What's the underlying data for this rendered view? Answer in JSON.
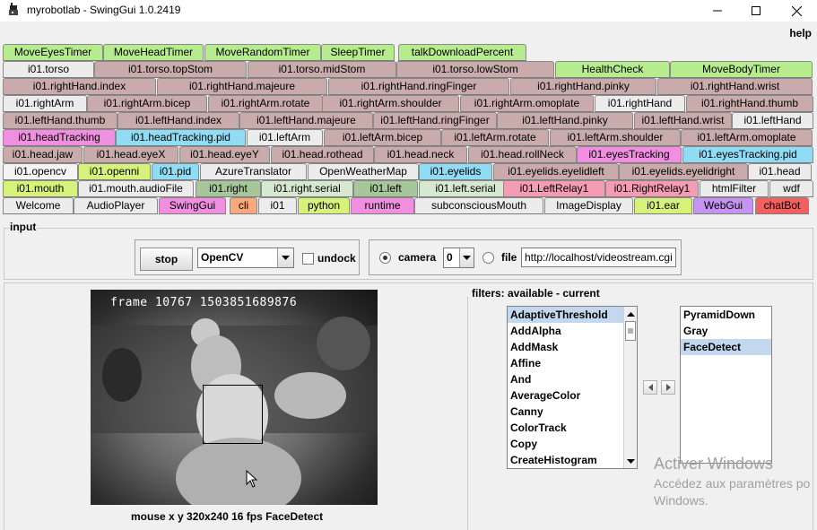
{
  "window": {
    "title": "myrobotlab - SwingGui 1.0.2419",
    "icon": "robot-app-icon",
    "controls": [
      "minimize-icon",
      "maximize-icon",
      "close-icon"
    ]
  },
  "menu": {
    "help": "help"
  },
  "colors": {
    "green": "#b6ec8e",
    "mauve": "#c9abab",
    "pink": "#f08fe0",
    "cyan": "#8fdcf4",
    "lime": "#d6f27a",
    "sage": "#a7c69a",
    "mint": "#d7e8d0",
    "rose": "#f59bb4",
    "orange": "#fba97a",
    "purple": "#c594f2",
    "red": "#f55f5f",
    "grey": "#ececec",
    "selected": "#f4f4f4",
    "list_selection": "#c3d7ef"
  },
  "tabs": [
    [
      {
        "label": "MoveEyesTimer",
        "color": "green"
      },
      {
        "label": "MoveHeadTimer",
        "color": "green"
      },
      {
        "label": "MoveRandomTimer",
        "color": "green"
      },
      {
        "label": "SleepTimer",
        "color": "green"
      },
      {
        "label": "talkDownloadPercent",
        "color": "green"
      }
    ],
    [
      {
        "label": "i01.torso",
        "color": "grey"
      },
      {
        "label": "i01.torso.topStom",
        "color": "mauve"
      },
      {
        "label": "i01.torso.midStom",
        "color": "mauve"
      },
      {
        "label": "i01.torso.lowStom",
        "color": "mauve"
      },
      {
        "label": "HealthCheck",
        "color": "green"
      },
      {
        "label": "MoveBodyTimer",
        "color": "green"
      }
    ],
    [
      {
        "label": "i01.rightHand.index",
        "color": "mauve"
      },
      {
        "label": "i01.rightHand.majeure",
        "color": "mauve"
      },
      {
        "label": "i01.rightHand.ringFinger",
        "color": "mauve"
      },
      {
        "label": "i01.rightHand.pinky",
        "color": "mauve"
      },
      {
        "label": "i01.rightHand.wrist",
        "color": "mauve"
      }
    ],
    [
      {
        "label": "i01.rightArm",
        "color": "grey"
      },
      {
        "label": "i01.rightArm.bicep",
        "color": "mauve"
      },
      {
        "label": "i01.rightArm.rotate",
        "color": "mauve"
      },
      {
        "label": "i01.rightArm.shoulder",
        "color": "mauve"
      },
      {
        "label": "i01.rightArm.omoplate",
        "color": "mauve"
      },
      {
        "label": "i01.rightHand",
        "color": "grey"
      },
      {
        "label": "i01.rightHand.thumb",
        "color": "mauve"
      }
    ],
    [
      {
        "label": "i01.leftHand.thumb",
        "color": "mauve"
      },
      {
        "label": "i01.leftHand.index",
        "color": "mauve"
      },
      {
        "label": "i01.leftHand.majeure",
        "color": "mauve"
      },
      {
        "label": "i01.leftHand.ringFinger",
        "color": "mauve"
      },
      {
        "label": "i01.leftHand.pinky",
        "color": "mauve"
      },
      {
        "label": "i01.leftHand.wrist",
        "color": "mauve"
      },
      {
        "label": "i01.leftHand",
        "color": "grey"
      }
    ],
    [
      {
        "label": "i01.headTracking",
        "color": "pink"
      },
      {
        "label": "i01.headTracking.pid",
        "color": "cyan"
      },
      {
        "label": "i01.leftArm",
        "color": "grey"
      },
      {
        "label": "i01.leftArm.bicep",
        "color": "mauve"
      },
      {
        "label": "i01.leftArm.rotate",
        "color": "mauve"
      },
      {
        "label": "i01.leftArm.shoulder",
        "color": "mauve"
      },
      {
        "label": "i01.leftArm.omoplate",
        "color": "mauve"
      }
    ],
    [
      {
        "label": "i01.head.jaw",
        "color": "mauve"
      },
      {
        "label": "i01.head.eyeX",
        "color": "mauve"
      },
      {
        "label": "i01.head.eyeY",
        "color": "mauve"
      },
      {
        "label": "i01.head.rothead",
        "color": "mauve"
      },
      {
        "label": "i01.head.neck",
        "color": "mauve"
      },
      {
        "label": "i01.head.rollNeck",
        "color": "mauve"
      },
      {
        "label": "i01.eyesTracking",
        "color": "pink"
      },
      {
        "label": "i01.eyesTracking.pid",
        "color": "cyan"
      }
    ],
    [
      {
        "label": "i01.opencv",
        "color": "cyan",
        "selected": true
      },
      {
        "label": "i01.openni",
        "color": "lime"
      },
      {
        "label": "i01.pid",
        "color": "cyan"
      },
      {
        "label": "AzureTranslator",
        "color": "grey"
      },
      {
        "label": "OpenWeatherMap",
        "color": "grey"
      },
      {
        "label": "i01.eyelids",
        "color": "cyan"
      },
      {
        "label": "i01.eyelids.eyelidleft",
        "color": "mauve"
      },
      {
        "label": "i01.eyelids.eyelidright",
        "color": "mauve"
      },
      {
        "label": "i01.head",
        "color": "grey"
      }
    ],
    [
      {
        "label": "i01.mouth",
        "color": "lime"
      },
      {
        "label": "i01.mouth.audioFile",
        "color": "grey"
      },
      {
        "label": "i01.right",
        "color": "sage"
      },
      {
        "label": "i01.right.serial",
        "color": "mint"
      },
      {
        "label": "i01.left",
        "color": "sage"
      },
      {
        "label": "i01.left.serial",
        "color": "mint"
      },
      {
        "label": "i01.LeftRelay1",
        "color": "rose"
      },
      {
        "label": "i01.RightRelay1",
        "color": "rose"
      },
      {
        "label": "htmlFilter",
        "color": "grey"
      },
      {
        "label": "wdf",
        "color": "grey"
      }
    ],
    [
      {
        "label": "Welcome",
        "color": "grey"
      },
      {
        "label": "AudioPlayer",
        "color": "grey"
      },
      {
        "label": "SwingGui",
        "color": "pink"
      },
      {
        "label": "cli",
        "color": "orange"
      },
      {
        "label": "i01",
        "color": "grey"
      },
      {
        "label": "python",
        "color": "lime"
      },
      {
        "label": "runtime",
        "color": "pink"
      },
      {
        "label": "subconsciousMouth",
        "color": "grey"
      },
      {
        "label": "ImageDisplay",
        "color": "grey"
      },
      {
        "label": "i01.ear",
        "color": "lime"
      },
      {
        "label": "WebGui",
        "color": "purple"
      },
      {
        "label": "chatBot",
        "color": "red"
      }
    ]
  ],
  "input": {
    "legend": "input",
    "stop_label": "stop",
    "grabber_selected": "OpenCV",
    "undock_label": "undock",
    "undock_checked": false,
    "camera_label": "camera",
    "camera_index": "0",
    "camera_selected": true,
    "file_label": "file",
    "file_url": "http://localhost/videostream.cgi"
  },
  "video": {
    "frame_text": "frame 10767 1503851689876",
    "status": "mouse x y 320x240  16 fps FaceDetect",
    "cursor": "arrow-cursor-icon"
  },
  "filters": {
    "label": "filters: available - current",
    "available": [
      "AdaptiveThreshold",
      "AddAlpha",
      "AddMask",
      "Affine",
      "And",
      "AverageColor",
      "Canny",
      "ColorTrack",
      "Copy",
      "CreateHistogram"
    ],
    "available_selected": "AdaptiveThreshold",
    "current": [
      "PyramidDown",
      "Gray",
      "FaceDetect"
    ],
    "current_selected": "FaceDetect"
  },
  "watermark": {
    "line1": "Activer Windows",
    "line2": "Accédez aux paramètres po",
    "line3": "Windows."
  }
}
